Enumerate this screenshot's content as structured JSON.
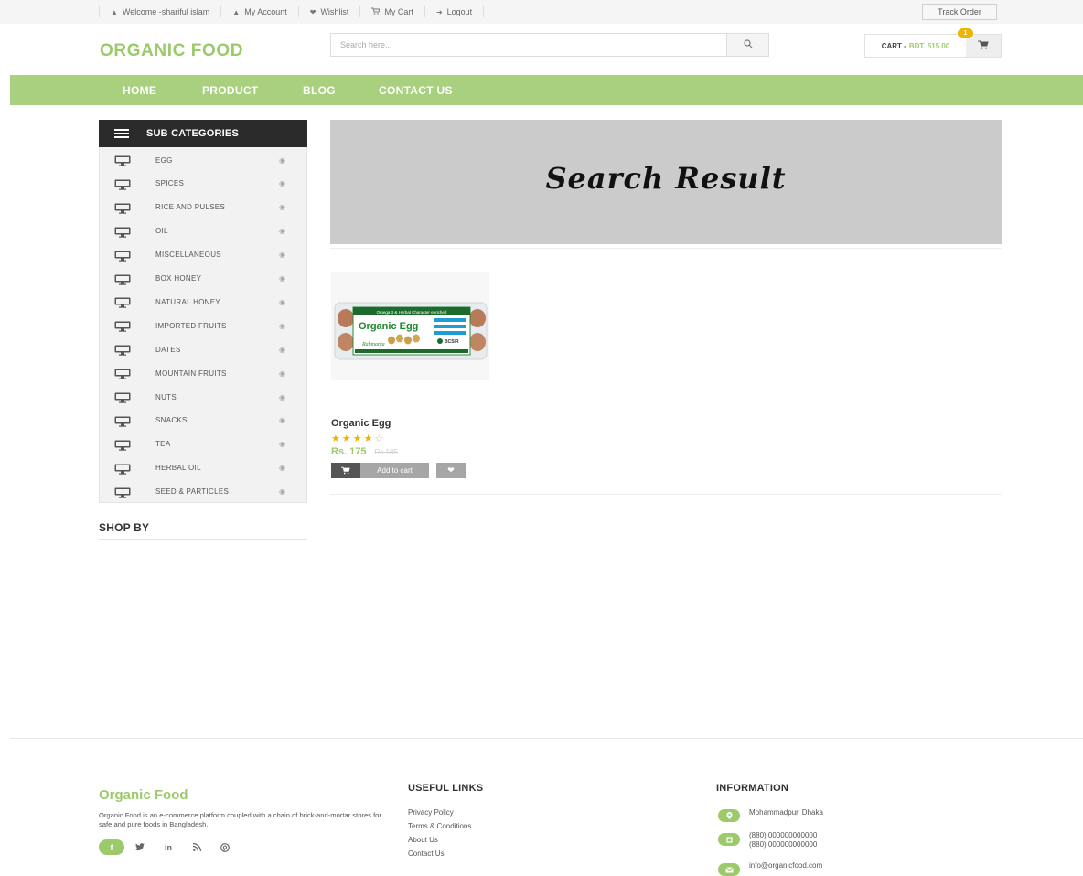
{
  "topbar": {
    "links": [
      {
        "label": "Welcome -shariful islam",
        "icon": "user-icon"
      },
      {
        "label": "My Account",
        "icon": "user-icon"
      },
      {
        "label": "Wishlist",
        "icon": "heart-icon"
      },
      {
        "label": "My Cart",
        "icon": "cart-icon"
      },
      {
        "label": "Logout",
        "icon": "logout-icon"
      }
    ],
    "track_order": "Track Order"
  },
  "header": {
    "logo": "ORGANIC FOOD",
    "search_placeholder": "Search here...",
    "cart_label": "CART -",
    "cart_amount": "BDT. 515.00",
    "cart_count": "1"
  },
  "nav": {
    "items": [
      "HOME",
      "PRODUCT",
      "BLOG",
      "CONTACT US"
    ]
  },
  "sidebar": {
    "title": "SUB CATEGORIES",
    "categories": [
      "EGG",
      "SPICES",
      "RICE AND PULSES",
      "OIL",
      "MISCELLANEOUS",
      "BOX HONEY",
      "NATURAL HONEY",
      "IMPORTED FRUITS",
      "DATES",
      "MOUNTAIN FRUITS",
      "NUTS",
      "SNACKS",
      "TEA",
      "HERBAL OIL",
      "SEED & PARTICLES"
    ],
    "shop_by": "SHOP BY"
  },
  "main": {
    "banner_text": "Search Result",
    "product": {
      "name": "Organic Egg",
      "rating": 4,
      "rating_max": 5,
      "price": "Rs. 175",
      "old_price": "Rs.185",
      "add_to_cart": "Add to cart",
      "image_top_text": "Omega 3 & Herbal Character enriched",
      "image_brand": "Organic Egg",
      "image_badge": "BCSIR"
    }
  },
  "footer": {
    "brand": "Organic Food",
    "description": "Organic Food is an e-commerce platform coupled with a chain of brick-and-mortar stores for safe and pure foods in Bangladesh.",
    "socials": [
      "f",
      "twitter-icon",
      "in",
      "rss-icon",
      "pinterest-icon"
    ],
    "useful_links_title": "USEFUL LINKS",
    "useful_links": [
      "Privacy Policy",
      "Terms & Conditions",
      "About Us",
      "Contact Us"
    ],
    "information_title": "INFORMATION",
    "address": "Mohammadpur, Dhaka",
    "phone_1": "(880) 000000000000",
    "phone_2": "(880) 000000000000",
    "email": "info@organicfood.com"
  },
  "colors": {
    "accent_green": "#9cca6b",
    "nav_green": "#a9d07e",
    "dark_header": "#2b2b2b",
    "badge_yellow": "#f0b400"
  }
}
